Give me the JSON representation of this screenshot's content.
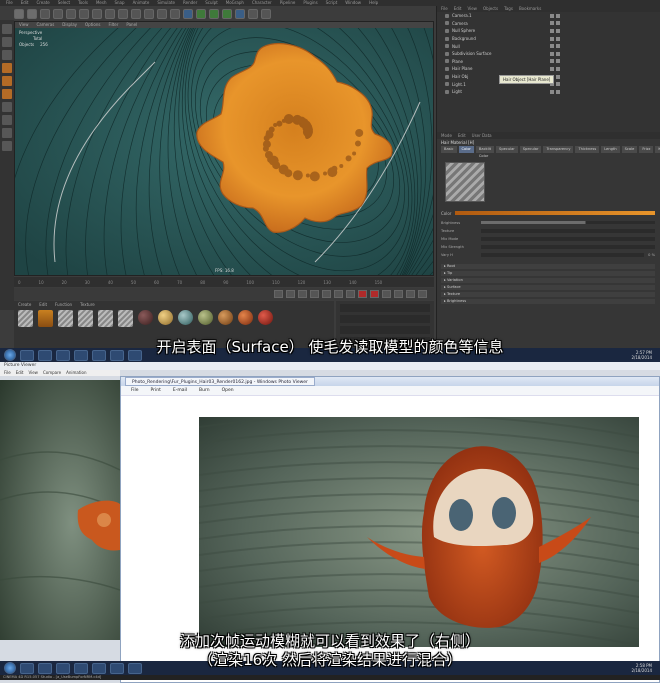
{
  "top": {
    "menubar": [
      "File",
      "Edit",
      "Create",
      "Select",
      "Tools",
      "Mesh",
      "Snap",
      "Animate",
      "Simulate",
      "Render",
      "Sculpt",
      "MoGraph",
      "Character",
      "Pipeline",
      "Plugins",
      "Script",
      "Window",
      "Help"
    ],
    "viewport": {
      "menu": [
        "View",
        "Cameras",
        "Display",
        "Options",
        "Filter",
        "Panel"
      ],
      "info_title": "Perspective",
      "info_total": "Total",
      "info_objects": "Objects",
      "info_count": "256",
      "fps": "FPS: 16.8"
    },
    "timeline_ticks": [
      "0",
      "10",
      "20",
      "30",
      "40",
      "50",
      "60",
      "70",
      "80",
      "90",
      "100",
      "110",
      "120",
      "130",
      "140",
      "150"
    ],
    "material_menu": [
      "Create",
      "Edit",
      "Function",
      "Texture"
    ],
    "object_manager": {
      "menu": [
        "File",
        "Edit",
        "View",
        "Objects",
        "Tags",
        "Bookmarks"
      ],
      "items": [
        "Camera.1",
        "Camera",
        "Null Sphere",
        "Background",
        "Null",
        "Subdivision Surface",
        "Plane",
        "Hair Plane",
        "Hair Obj",
        "Light.1",
        "Light"
      ],
      "tooltip": "Hair Object [Hair Plane]"
    },
    "attribute_manager": {
      "menu": [
        "Mode",
        "Edit",
        "User Data"
      ],
      "title": "Hair Material [H]",
      "tabs": [
        "Basic",
        "Color",
        "Backlit Color",
        "Specular",
        "Specular",
        "Transparency",
        "Thickness",
        "Length",
        "Scale",
        "Frizz",
        "Kink",
        "Displacement",
        "Illumination"
      ],
      "color_label": "Color",
      "lines": [
        {
          "label": "Brightness"
        },
        {
          "label": "Texture"
        },
        {
          "label": "Mix Mode"
        },
        {
          "label": "Mix Strength"
        },
        {
          "label": "Vary H",
          "value": "0 %"
        }
      ],
      "sections": [
        "Root",
        "Tip",
        "Variation",
        "Surface",
        "Texture",
        "Brightness"
      ]
    },
    "subtitle": "开启表面（Surface） 使毛发读取模型的颜色等信息",
    "status_text": "Azimuth: 200.0° Altitude: 47.1° Z",
    "taskbar_time": "2:57 PM",
    "taskbar_date": "2/18/2014"
  },
  "bottom": {
    "picture_viewer_title": "Picture Viewer",
    "picture_viewer_menu": [
      "File",
      "Edit",
      "View",
      "Compare",
      "Animation"
    ],
    "photo_viewer_tab": "Photo_Rendering\\Fur_Plugins_Hair03_Render0162.jpg - Windows Photo Viewer",
    "photo_viewer_menu": [
      "File",
      "Print",
      "E-mail",
      "Burn",
      "Open"
    ],
    "subtitle_line1": "添加次帧运动模糊就可以看到效果了（右侧）",
    "subtitle_line2": "（渲染16次 然后将渲染结果进行混合）",
    "status_text": "CINEMA 4D R15.057 Studio - [a_UseBumpForNRM.c4d]",
    "taskbar_time": "2:58 PM",
    "taskbar_date": "2/18/2014"
  },
  "colors": {
    "fur_orange": "#e8952b",
    "viewport_teal": "#2c5a5a",
    "accent_blue": "#5a6c8a"
  }
}
